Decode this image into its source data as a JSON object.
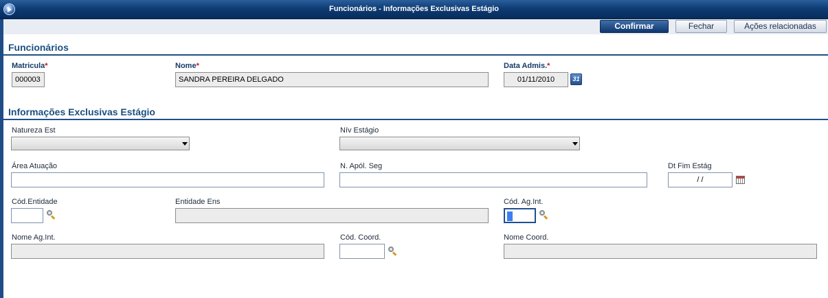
{
  "window": {
    "title": "Funcionários - Informações Exclusivas Estágio"
  },
  "toolbar": {
    "confirm_label": "Confirmar",
    "close_label": "Fechar",
    "actions_label": "Ações relacionadas"
  },
  "section_employees": {
    "title": "Funcionários",
    "matricula": {
      "label": "Matricula",
      "required_mark": "*",
      "value": "000003"
    },
    "nome": {
      "label": "Nome",
      "required_mark": "*",
      "value": "SANDRA PEREIRA DELGADO"
    },
    "data_admis": {
      "label": "Data Admis.",
      "required_mark": "*",
      "value": "01/11/2010"
    },
    "calendar_icon_text": "31"
  },
  "section_internship": {
    "title": "Informações Exclusivas Estágio",
    "natureza_est": {
      "label": "Natureza Est",
      "value": ""
    },
    "niv_estagio": {
      "label": "Nív Estágio",
      "value": ""
    },
    "area_atuacao": {
      "label": "Área Atuação",
      "value": ""
    },
    "n_apol_seg": {
      "label": "N. Apól. Seg",
      "value": ""
    },
    "dt_fim_estag": {
      "label": "Dt Fim Estág",
      "value": "/ /"
    },
    "cod_entidade": {
      "label": "Cód.Entidade",
      "value": ""
    },
    "entidade_ens": {
      "label": "Entidade Ens",
      "value": ""
    },
    "cod_ag_int": {
      "label": "Cód. Ag.Int.",
      "value": ""
    },
    "nome_ag_int": {
      "label": "Nome Ag.Int.",
      "value": ""
    },
    "cod_coord": {
      "label": "Cód. Coord.",
      "value": ""
    },
    "nome_coord": {
      "label": "Nome Coord.",
      "value": ""
    }
  },
  "colors": {
    "titlebar": "#0f3c74",
    "section_title": "#1b4f82",
    "required": "#d01010",
    "primary_button": "#10376e"
  },
  "icons": {
    "app": "app-logo-icon",
    "lookup": "magnifier-icon",
    "calendar": "calendar-icon"
  }
}
